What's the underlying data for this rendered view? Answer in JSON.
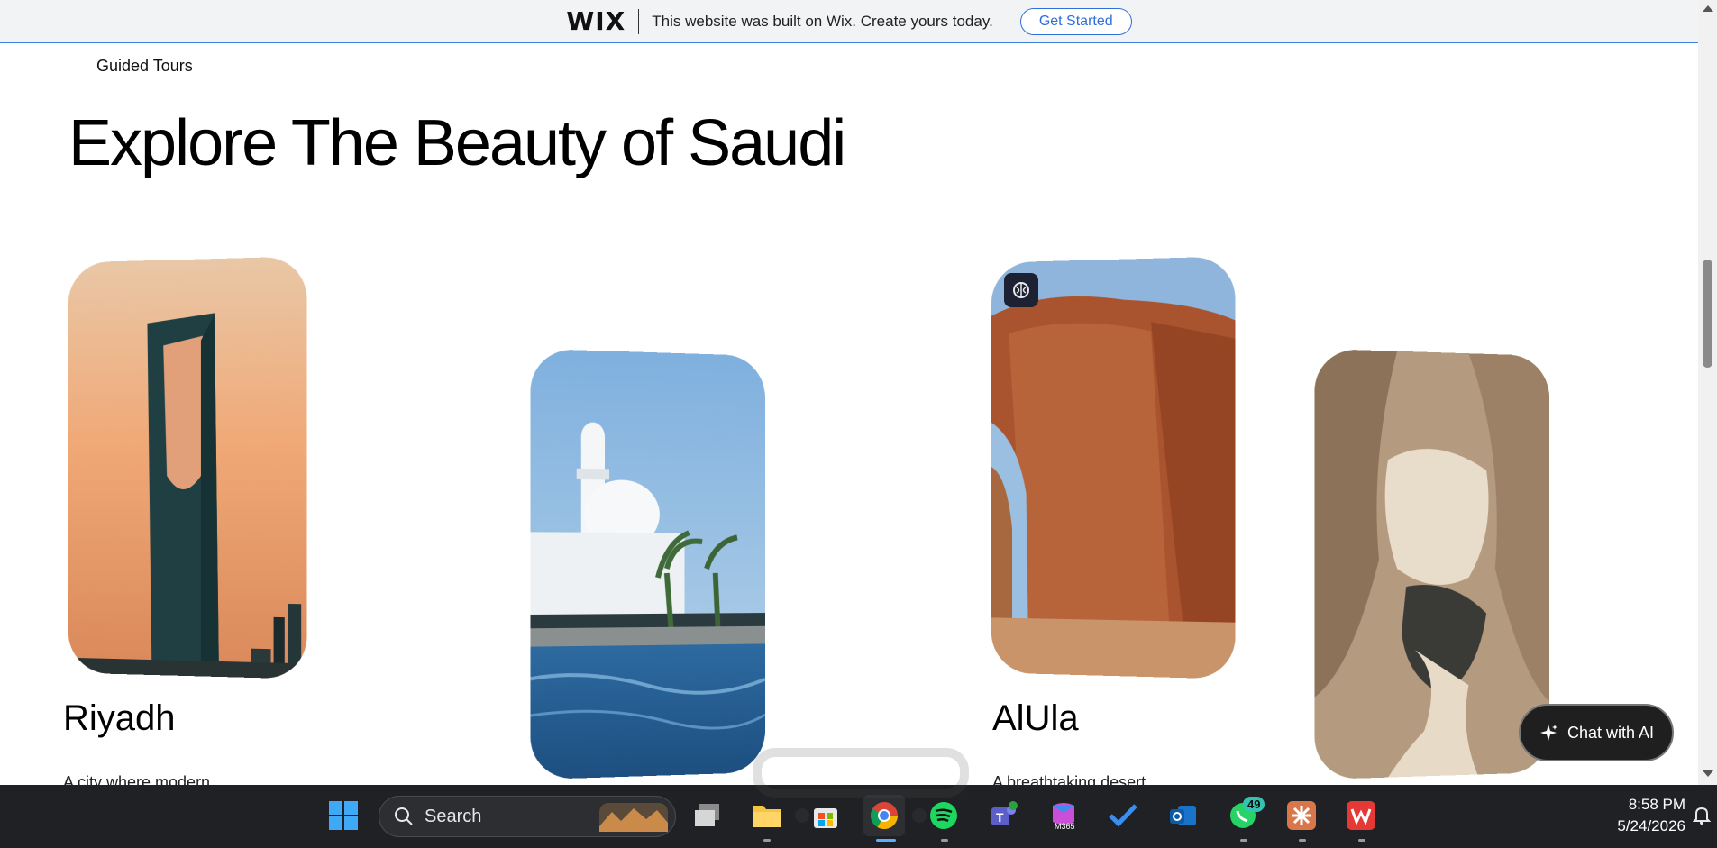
{
  "wix_banner": {
    "logo": "WIX",
    "message": "This website was built on Wix. Create yours today.",
    "cta": "Get Started"
  },
  "nav": {
    "guided_tours": "Guided Tours"
  },
  "page": {
    "title": "Explore The Beauty of Saudi"
  },
  "cards": [
    {
      "name": "Riyadh",
      "description": "A city where modern"
    },
    {
      "name": "AlUla",
      "description": "A breathtaking desert"
    }
  ],
  "chat": {
    "label": "Chat with AI"
  },
  "taskbar": {
    "search_placeholder": "Search",
    "whatsapp_badge": "49",
    "clock_time": "8:58 PM",
    "clock_date": "5/24/2026"
  },
  "colors": {
    "wix_accent": "#2f6fd9",
    "taskbar_bg": "#202124",
    "chat_bg": "#1f1f1f"
  }
}
